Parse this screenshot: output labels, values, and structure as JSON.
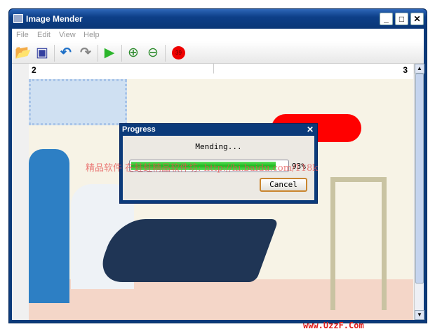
{
  "window": {
    "title": "Image Mender",
    "controls": [
      "_",
      "□",
      "✕"
    ]
  },
  "menu": [
    "File",
    "Edit",
    "View",
    "Help"
  ],
  "toolbar": {
    "badge": "39"
  },
  "ruler": {
    "left": "2",
    "right": "3"
  },
  "dialog": {
    "title": "Progress",
    "close": "✕",
    "status": "Mending...",
    "percent_label": "93%",
    "progress": 0.93,
    "cancel": "Cancel"
  },
  "watermark": {
    "center": "精品软件 在蛙蛙精品软件坊: http://hi.baidu.com/118k",
    "bottom": "www.UzzF.Com"
  },
  "colors": {
    "title": "#0b3a7a",
    "progress": "#1fb81f"
  }
}
